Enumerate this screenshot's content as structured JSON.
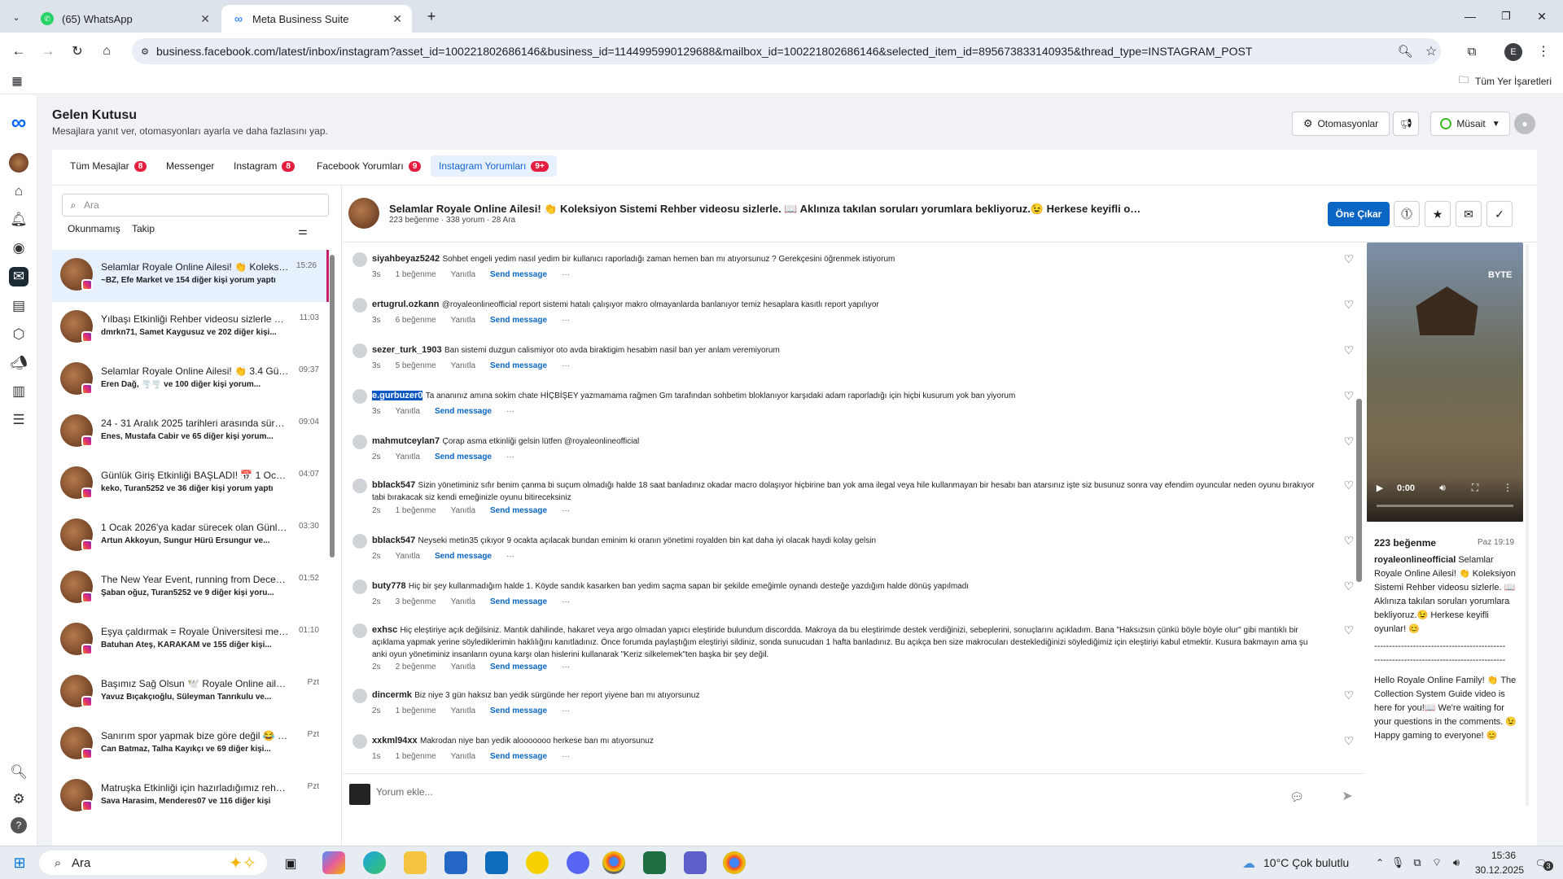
{
  "browser": {
    "tabs": [
      {
        "title": "(65) WhatsApp"
      },
      {
        "title": "Meta Business Suite"
      }
    ],
    "url": "business.facebook.com/latest/inbox/instagram?asset_id=100221802686146&business_id=1144995990129688&mailbox_id=100221802686146&selected_item_id=895673833140935&thread_type=INSTAGRAM_POST",
    "bookmarks_label": "Tüm Yer İşaretleri",
    "profile_initial": "E"
  },
  "header": {
    "title": "Gelen Kutusu",
    "subtitle": "Mesajlara yanıt ver, otomasyonları ayarla ve daha fazlasını yap.",
    "automations": "Otomasyonlar",
    "status": "Müsait"
  },
  "filter_tabs": [
    {
      "label": "Tüm Mesajlar",
      "badge": "8"
    },
    {
      "label": "Messenger",
      "badge": ""
    },
    {
      "label": "Instagram",
      "badge": "8"
    },
    {
      "label": "Facebook Yorumları",
      "badge": "9"
    },
    {
      "label": "Instagram Yorumları",
      "badge": "9+"
    }
  ],
  "list": {
    "search_placeholder": "Ara",
    "chips": [
      "Okunmamış",
      "Takip"
    ],
    "items": [
      {
        "title": "Selamlar Royale Online Ailesi! 👏 Koleksiyo...",
        "sub": "~BZ, Efe Market ve 154 diğer kişi yorum yaptı",
        "time": "15:26"
      },
      {
        "title": "Yılbaşı Etkinliği Rehber videosu sizlerle Roy...",
        "sub": "dmrkn71, Samet Kaygusuz ve 202 diğer kişi...",
        "time": "11:03"
      },
      {
        "title": "Selamlar Royale Online Ailesi! 👏 3.4 Günce...",
        "sub": "Eren Dağ, 🌪️🌪️ ve 100 diğer kişi yorum...",
        "time": "09:37"
      },
      {
        "title": "24 - 31 Aralık 2025 tarihleri arasında sürece...",
        "sub": "Enes, Mustafa Cabir ve 65 diğer kişi yorum...",
        "time": "09:04"
      },
      {
        "title": "Günlük Giriş Etkinliği BAŞLADI! 📅 1 Ocak'...",
        "sub": "keko, Turan5252 ve 36 diğer kişi yorum yaptı",
        "time": "04:07"
      },
      {
        "title": "1 Ocak 2026'ya kadar sürecek olan Günlük ...",
        "sub": "Artun Akkoyun, Sungur Hürü Ersungur ve...",
        "time": "03:30"
      },
      {
        "title": "The New Year Event, running from Decemb...",
        "sub": "Şaban oğuz, Turan5252 ve 9 diğer kişi yoru...",
        "time": "01:52"
      },
      {
        "title": "Eşya çaldırmak = Royale Üniversitesi mezu...",
        "sub": "Batuhan Ateş, KARAKAM ve 155 diğer kişi...",
        "time": "01:10"
      },
      {
        "title": "Başımız Sağ Olsun 🕊️ Royale Online ailesi o...",
        "sub": "Yavuz Bıçakçıoğlu, Süleyman Tanrıkulu ve...",
        "time": "Pzt"
      },
      {
        "title": "Sanırım spor yapmak bize göre değil 😂 - I ...",
        "sub": "Can Batmaz, Talha Kayıkçı ve 69 diğer kişi...",
        "time": "Pzt"
      },
      {
        "title": "Matruşka Etkinliği için hazırladığımız rehber...",
        "sub": "Sava Harasim, Menderes07 ve 116 diğer kişi",
        "time": "Pzt"
      }
    ]
  },
  "post": {
    "title": "Selamlar Royale Online Ailesi! 👏 Koleksiyon Sistemi Rehber videosu sizlerle. 📖 Aklınıza takılan soruları yorumlara bekliyoruz.😉 Herkese keyifli oyunlar!...",
    "meta": "223 beğenme · 338 yorum · 28 Ara",
    "unpin": "Öne Çıkar"
  },
  "comment_actions": {
    "reply": "Yanıtla",
    "send": "Send message"
  },
  "comments": [
    {
      "user": "siyahbeyaz5242",
      "text": "Sohbet engeli yedim nasıl yedim bir kullanıcı raporladığı zaman hemen ban mı atıyorsunuz ? Gerekçesini öğrenmek istiyorum",
      "age": "3s",
      "likes": "1 beğenme"
    },
    {
      "user": "ertugrul.ozkann",
      "text": "@royaleonlineofficial report sistemi hatalı çalışıyor makro olmayanlarda banlanıyor temiz hesaplara kasıtlı report yapılıyor",
      "age": "3s",
      "likes": "6 beğenme"
    },
    {
      "user": "sezer_turk_1903",
      "text": "Ban sistemi duzgun calismiyor oto avda biraktigim hesabim nasil ban yer anlam veremiyorum",
      "age": "3s",
      "likes": "5 beğenme"
    },
    {
      "user": "e.gurbuzer0",
      "text": "Ta ananınız amına sokim chate HİÇBİŞEY yazmamama rağmen Gm tarafından sohbetim bloklanıyor karşıdaki adam raporladığı için hiçbi kusurum yok ban yiyorum",
      "age": "3s",
      "likes": ""
    },
    {
      "user": "mahmutceylan7",
      "text": "Çorap asma etkinliği gelsin lütfen @royaleonlineofficial",
      "age": "2s",
      "likes": ""
    },
    {
      "user": "bblack547",
      "text": "Sizin yönetiminiz sıfır benim çanma bi suçum olmadığı halde 18 saat banladınız okadar macro dolaşıyor hiçbirine ban yok ama ilegal veya hile kullanmayan bir hesabı ban atarsınız işte siz busunuz sonra vay efendim oyuncular neden oyunu bırakıyor tabi bırakacak siz kendi emeğinizle oyunu bitireceksiniz",
      "age": "2s",
      "likes": "1 beğenme"
    },
    {
      "user": "bblack547",
      "text": "Neyseki metin35 çıkıyor 9 ocakta açılacak bundan eminim ki oranın yönetimi royalden bin kat daha iyi olacak haydi kolay gelsin",
      "age": "2s",
      "likes": ""
    },
    {
      "user": "buty778",
      "text": "Hiç bir şey kullanmadığım halde 1. Köyde sandık kasarken ban yedim saçma sapan bir şekilde emeğimle oynandı desteğe yazdığım halde dönüş yapılmadı",
      "age": "2s",
      "likes": "3 beğenme"
    },
    {
      "user": "exhsc",
      "text": "Hiç eleştiriye açık değilsiniz. Mantık dahilinde, hakaret veya argo olmadan yapıcı eleştiride bulundum discordda. Makroya da bu eleştirimde destek verdiğinizi, sebeplerini, sonuçlarını açıkladım. Bana \"Haksızsın çünkü böyle böyle olur\" gibi mantıklı bir açıklama yapmak yerine söylediklerimin haklılığını kanıtladınız. Önce forumda paylaştığım eleştiriyi sildiniz, sonda sunucudan 1 hafta banladınız. Bu açıkça ben size makrocuları desteklediğinizi söylediğimiz için eleştiriyi kabul etmektir. Kusura bakmayın ama şu anki oyun yönetiminiz insanların oyuna karşı olan hislerini kullanarak \"Keriz silkelemek\"ten başka bir şey değil.",
      "age": "2s",
      "likes": "2 beğenme"
    },
    {
      "user": "dincermk",
      "text": "Biz niye 3 gün haksız ban yedik sürgünde her report yiyene ban mı atıyorsunuz",
      "age": "2s",
      "likes": "1 beğenme"
    },
    {
      "user": "xxkml94xx",
      "text": "Makrodan niye ban yedik alooooooo herkese ban mı atıyorsunuz",
      "age": "1s",
      "likes": "1 beğenme"
    }
  ],
  "composer": {
    "placeholder": "Yorum ekle..."
  },
  "media": {
    "time": "0:00",
    "watermark": "BYTE",
    "likes": "223 beğenme",
    "date": "Paz 19:19",
    "author": "royaleonlineofficial",
    "caption_tr": "Selamlar Royale Online Ailesi! 👏 Koleksiyon Sistemi Rehber videosu sizlerle. 📖 Aklınıza takılan soruları yorumlara bekliyoruz.😉 Herkese keyifli oyunlar! 😊",
    "divider": "--------------------------------------------",
    "caption_en": "Hello Royale Online Family! 👏 The Collection System Guide video is here for you!📖 We're waiting for your questions in the comments. 😉 Happy gaming to everyone! 😊"
  },
  "taskbar": {
    "search": "Ara",
    "weather": "10°C  Çok bulutlu",
    "time": "15:36",
    "date": "30.12.2025",
    "notif": "3"
  }
}
